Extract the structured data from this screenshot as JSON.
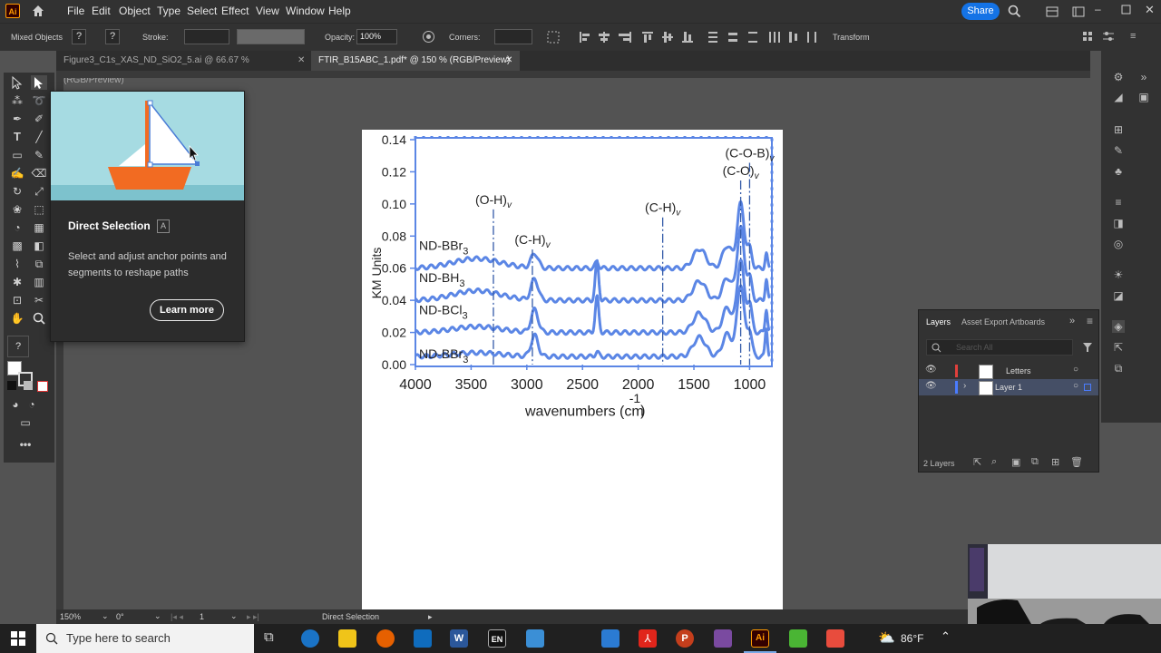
{
  "app": {
    "logo": "Ai",
    "menu": [
      "File",
      "Edit",
      "Object",
      "Type",
      "Select",
      "Effect",
      "View",
      "Window",
      "Help"
    ],
    "share_label": "Share"
  },
  "control_bar": {
    "selection": "Mixed Objects",
    "stroke_label": "Stroke:",
    "opacity_label": "Opacity:",
    "opacity_value": "100%",
    "corners_label": "Corners:",
    "transform_label": "Transform"
  },
  "tabs": [
    {
      "label": "Figure3_C1s_XAS_ND_SiO2_5.ai @ 66.67 % (RGB/Preview)",
      "active": false
    },
    {
      "label": "FTIR_B15ABC_1.pdf* @ 150 % (RGB/Preview)",
      "active": true
    }
  ],
  "tooltip": {
    "title": "Direct Selection",
    "shortcut": "A",
    "description": "Select and adjust anchor points and segments to reshape paths",
    "learn_more": "Learn more"
  },
  "layers_panel": {
    "tabs": [
      "Layers",
      "Asset Export",
      "Artboards"
    ],
    "search_placeholder": "Search All",
    "layers": [
      {
        "name": "Letters",
        "color": "#e0403c"
      },
      {
        "name": "Layer 1",
        "color": "#4a7cff"
      }
    ],
    "count": "2 Layers"
  },
  "status_bar": {
    "zoom": "150%",
    "rotation": "0°",
    "artboard": "1",
    "tool": "Direct Selection"
  },
  "taskbar": {
    "search_placeholder": "Type here to search",
    "weather": "86°F"
  },
  "chart_data": {
    "type": "line",
    "xlabel": "wavenumbers (cm",
    "xlabel_sup": "-1",
    "ylabel": "KM Units",
    "x_ticks": [
      "4000",
      "3500",
      "3000",
      "2500",
      "2000",
      "1500",
      "1000"
    ],
    "y_ticks": [
      "0.00",
      "0.02",
      "0.04",
      "0.06",
      "0.08",
      "0.10",
      "0.12",
      "0.14"
    ],
    "xlim": [
      4000,
      800
    ],
    "ylim": [
      0,
      0.14
    ],
    "color": "#5b86e5",
    "series": [
      {
        "name": "ND-BBr3",
        "offset": 0.06
      },
      {
        "name": "ND-BH3",
        "offset": 0.04
      },
      {
        "name": "ND-BCl3",
        "offset": 0.02
      },
      {
        "name": "ND-BBr3",
        "offset": 0.005
      }
    ],
    "annotations": [
      {
        "label": "(O-H)",
        "sub": "v",
        "x": 3300,
        "y": 0.1
      },
      {
        "label": "(C-H)",
        "sub": "v",
        "x": 2950,
        "y": 0.075
      },
      {
        "label": "(C-H)",
        "sub": "v",
        "x": 1780,
        "y": 0.095
      },
      {
        "label": "(C-O)",
        "sub": "v",
        "x": 1080,
        "y": 0.118
      },
      {
        "label": "(C-O-B)",
        "sub": "v",
        "x": 1000,
        "y": 0.129
      }
    ]
  }
}
